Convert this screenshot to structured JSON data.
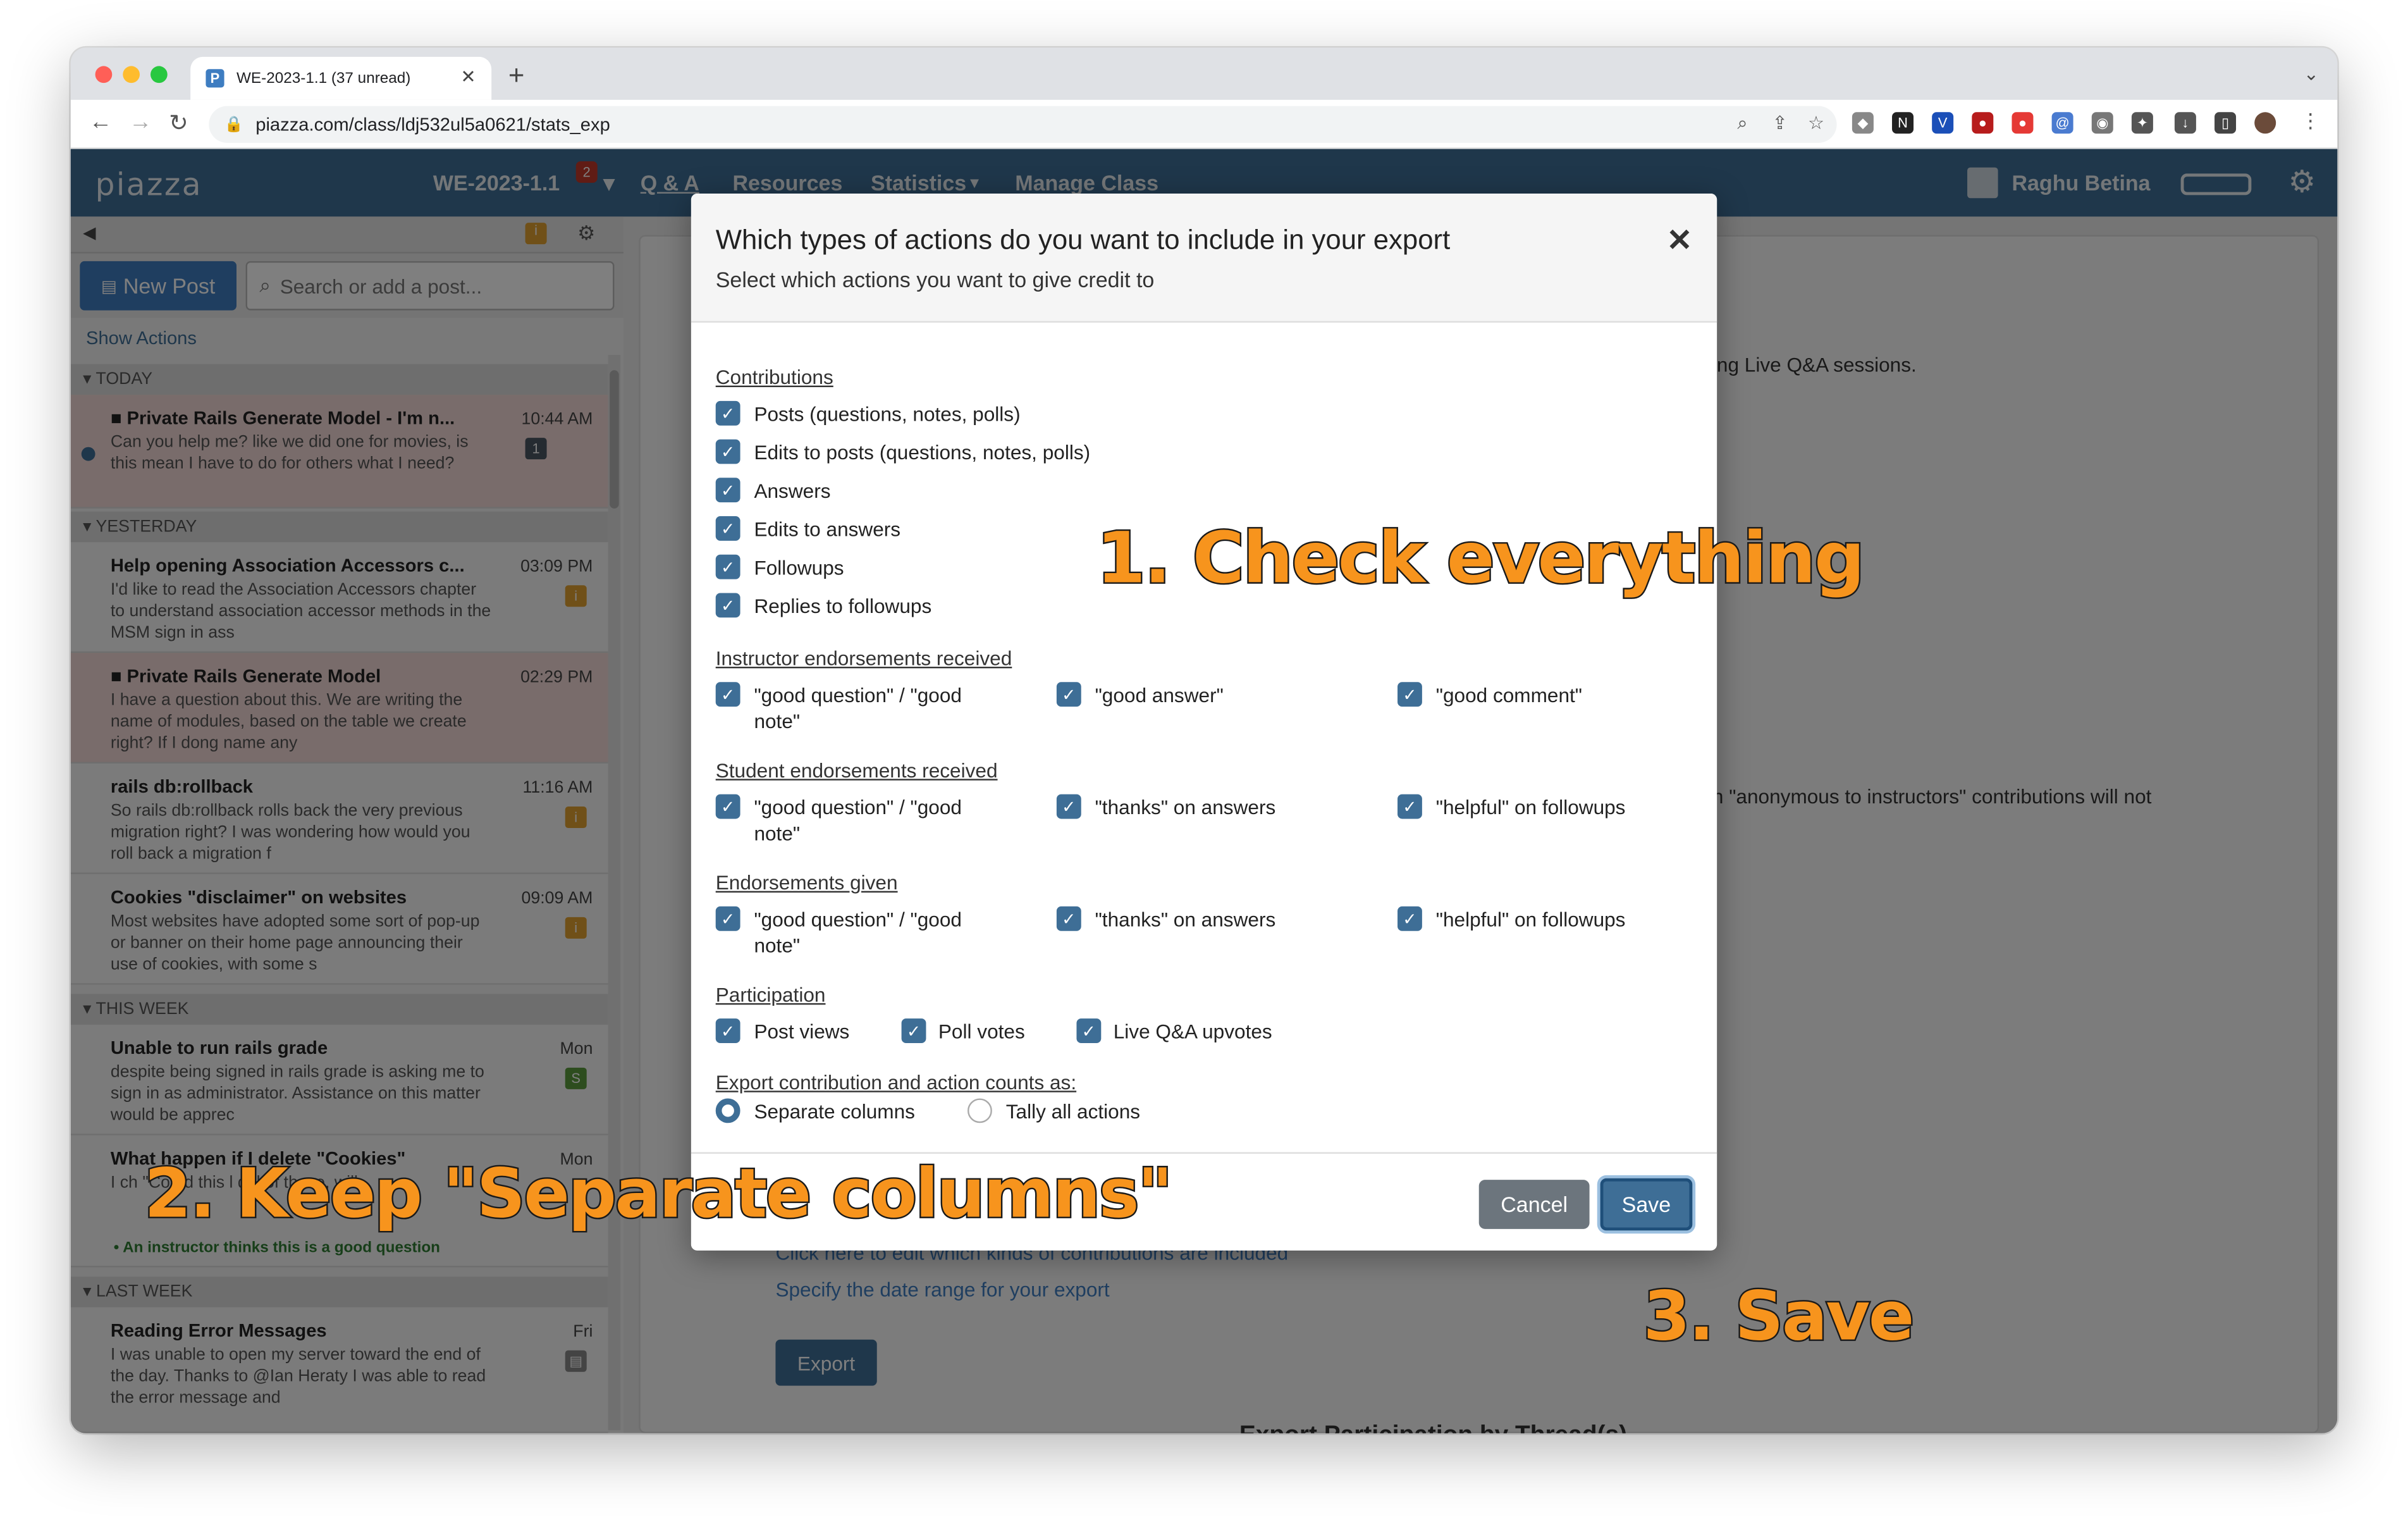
{
  "browser": {
    "tab_title": "WE-2023-1.1 (37 unread)",
    "favicon_letter": "P",
    "url": "piazza.com/class/ldj532ul5a0621/stats_exp",
    "close_glyph": "✕",
    "newtab_glyph": "+"
  },
  "app": {
    "logo": "piazza",
    "class_name": "WE-2023-1.1",
    "unread_badge": "2",
    "nav": [
      "Q & A",
      "Resources",
      "Statistics",
      "Manage Class"
    ],
    "user_name": "Raghu Betina"
  },
  "sidebar": {
    "new_post": "New Post",
    "search_placeholder": "Search or add a post...",
    "show_actions": "Show Actions",
    "sections": [
      "TODAY",
      "YESTERDAY",
      "THIS WEEK",
      "LAST WEEK"
    ],
    "posts": [
      {
        "title": "■ Private  Rails Generate Model - I'm n...",
        "body": "Can you help me? like we did one for movies, is this mean I have to do for others what I need?",
        "time": "10:44 AM",
        "badge": "1"
      },
      {
        "title": "Help opening Association Accessors c...",
        "body": "I'd like to read the Association Accessors chapter to understand association accessor methods in the MSM sign in ass",
        "time": "03:09 PM",
        "badge": "i"
      },
      {
        "title": "■ Private  Rails Generate Model",
        "body": "I have a question about this. We are writing the name of modules, based on the table we create right? If I dong name any",
        "time": "02:29 PM",
        "badge": ""
      },
      {
        "title": "rails db:rollback",
        "body": "So rails db:rollback rolls back the very previous migration right? I was wondering how would you roll back a migration f",
        "time": "11:16 AM",
        "badge": "i"
      },
      {
        "title": "Cookies \"disclaimer\" on websites",
        "body": "Most websites have adopted some sort of pop-up or banner on their home page announcing their use of cookies, with some s",
        "time": "09:09 AM",
        "badge": "i"
      },
      {
        "title": "Unable to run rails grade",
        "body": "despite being signed in rails grade is asking me to sign in as administrator.  Assistance on this matter would be apprec",
        "time": "Mon",
        "badge": "S"
      },
      {
        "title": "What happen if I delete \"Cookies\"",
        "body": "I ch    \"Co          nd  this           l del  of those, will",
        "time": "Mon",
        "badge": ""
      },
      {
        "title": "Reading Error Messages",
        "body": "I was unable to open my server toward the end of the day. Thanks to @Ian Heraty I was able to read the error message and",
        "time": "Fri",
        "badge": ""
      }
    ],
    "endorse_note": "• An instructor thinks this is a good question"
  },
  "main": {
    "text_live": "ing Live Q&A sessions.",
    "text_anon": "n \"anonymous to instructors\" contributions will not",
    "link_edit": "Click here to edit which kinds of contributions are included",
    "link_date": "Specify the date range for your export",
    "export_button": "Export",
    "section_heading": "Export Participation by Thread(s)"
  },
  "modal": {
    "title": "Which types of actions do you want to include in your export",
    "subtitle": "Select which actions you want to give credit to",
    "close": "✕",
    "groups": {
      "contributions": {
        "label": "Contributions",
        "items": [
          "Posts (questions, notes, polls)",
          "Edits to posts (questions, notes, polls)",
          "Answers",
          "Edits to answers",
          "Followups",
          "Replies to followups"
        ]
      },
      "instructor": {
        "label": "Instructor endorsements received",
        "items": [
          "\"good question\" / \"good note\"",
          "\"good answer\"",
          "\"good comment\""
        ]
      },
      "student": {
        "label": "Student endorsements received",
        "items": [
          "\"good question\" / \"good note\"",
          "\"thanks\" on answers",
          "\"helpful\" on followups"
        ]
      },
      "given": {
        "label": "Endorsements given",
        "items": [
          "\"good question\" / \"good note\"",
          "\"thanks\" on answers",
          "\"helpful\" on followups"
        ]
      },
      "participation": {
        "label": "Participation",
        "items": [
          "Post views",
          "Poll votes",
          "Live Q&A upvotes"
        ]
      }
    },
    "export_as_label": "Export contribution and action counts as:",
    "radio_separate": "Separate columns",
    "radio_tally": "Tally all actions",
    "selected": "Separate columns",
    "cancel": "Cancel",
    "save": "Save"
  },
  "annotations": {
    "step1": "1. Check everything",
    "step2": "2. Keep \"Separate columns\"",
    "step3": "3. Save"
  },
  "colors": {
    "accent": "#3e6e96",
    "annotation": "#f7941d"
  }
}
